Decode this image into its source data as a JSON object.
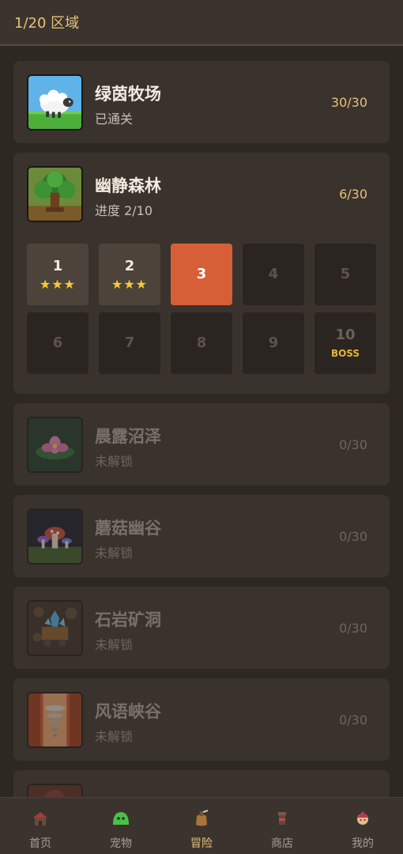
{
  "header": {
    "title": "1/20 区域"
  },
  "zones": [
    {
      "name": "绿茵牧场",
      "status": "已通关",
      "progress": "30/30",
      "icon": "sheep-icon"
    },
    {
      "name": "幽静森林",
      "status": "进度 2/10",
      "progress": "6/30",
      "icon": "tree-icon"
    },
    {
      "name": "晨露沼泽",
      "status": "未解锁",
      "progress": "0/30",
      "icon": "lotus-icon"
    },
    {
      "name": "蘑菇幽谷",
      "status": "未解锁",
      "progress": "0/30",
      "icon": "mushroom-icon"
    },
    {
      "name": "石岩矿洞",
      "status": "未解锁",
      "progress": "0/30",
      "icon": "crystal-cart-icon"
    },
    {
      "name": "风语峡谷",
      "status": "未解锁",
      "progress": "0/30",
      "icon": "tornado-icon"
    }
  ],
  "levels": [
    {
      "num": "1",
      "stars": "★★★",
      "state": "done"
    },
    {
      "num": "2",
      "stars": "★★★",
      "state": "done"
    },
    {
      "num": "3",
      "state": "current"
    },
    {
      "num": "4",
      "state": "locked"
    },
    {
      "num": "5",
      "state": "locked"
    },
    {
      "num": "6",
      "state": "locked"
    },
    {
      "num": "7",
      "state": "locked"
    },
    {
      "num": "8",
      "state": "locked"
    },
    {
      "num": "9",
      "state": "locked"
    },
    {
      "num": "10",
      "tag": "BOSS",
      "state": "boss"
    }
  ],
  "tabs": [
    {
      "label": "首页",
      "icon": "home-icon"
    },
    {
      "label": "宠物",
      "icon": "slime-icon"
    },
    {
      "label": "冒险",
      "icon": "bag-icon",
      "active": true
    },
    {
      "label": "商店",
      "icon": "shop-icon"
    },
    {
      "label": "我的",
      "icon": "profile-icon"
    }
  ],
  "colors": {
    "accent": "#d65f37",
    "gold": "#e6c27a",
    "star": "#f5c93a",
    "background": "#2e2823"
  }
}
